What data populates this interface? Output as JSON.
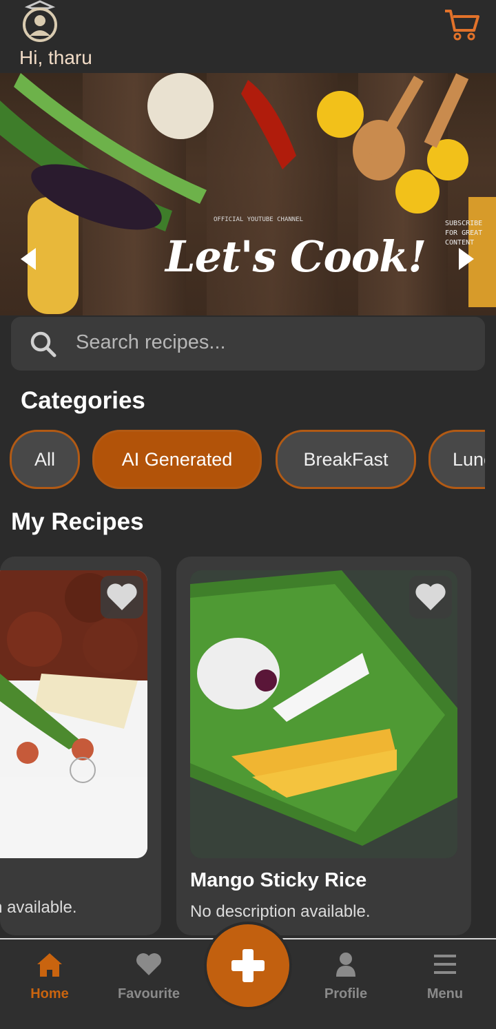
{
  "header": {
    "greeting": "Hi, tharu"
  },
  "banner": {
    "title": "Let's Cook!",
    "small_text": "OFFICIAL YOUTUBE CHANNEL",
    "side_text": "SUBSCRIBE FOR GREAT CONTENT",
    "dots_total": 5,
    "dots_active_index": 2
  },
  "search": {
    "placeholder": "Search recipes..."
  },
  "categories": {
    "title": "Categories",
    "items": [
      {
        "label": "All",
        "active": false
      },
      {
        "label": "AI Generated",
        "active": true
      },
      {
        "label": "BreakFast",
        "active": false
      },
      {
        "label": "Lunch",
        "active": false
      }
    ]
  },
  "my_recipes": {
    "title": "My Recipes",
    "cards": [
      {
        "title": "",
        "description": "No description available."
      },
      {
        "title": "Mango Sticky Rice",
        "description": "No description available."
      }
    ]
  },
  "nav": {
    "items": [
      {
        "label": "Home",
        "icon": "home-icon",
        "active": true
      },
      {
        "label": "Favourite",
        "icon": "heart-icon",
        "active": false
      },
      {
        "label": "Profile",
        "icon": "user-icon",
        "active": false
      },
      {
        "label": "Menu",
        "icon": "menu-icon",
        "active": false
      }
    ],
    "fab_icon": "plus-icon"
  },
  "colors": {
    "accent": "#c2600f",
    "background": "#2b2b2b",
    "card": "#3a3a3a"
  }
}
